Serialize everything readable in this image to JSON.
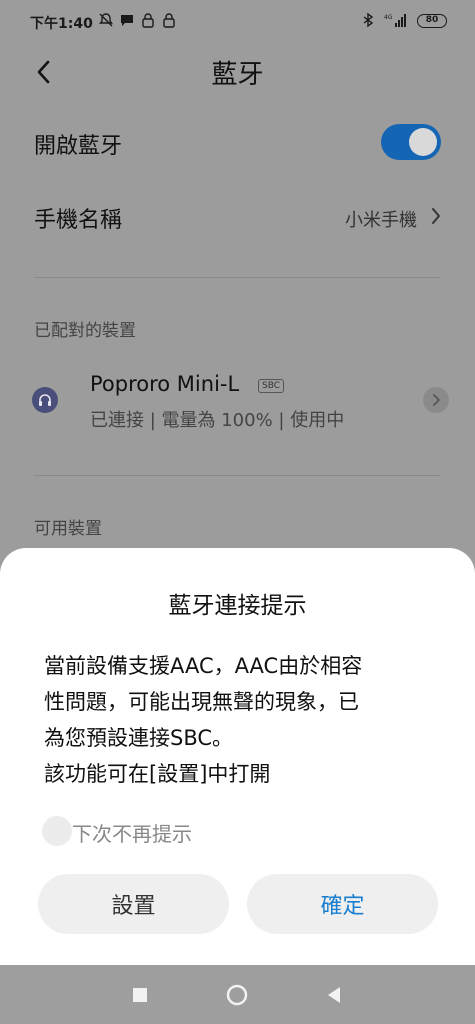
{
  "status_bar": {
    "time": "下午1:40",
    "battery": "80",
    "network": "4G"
  },
  "header": {
    "title": "藍牙",
    "back_icon": "chevron-left-icon"
  },
  "settings": {
    "bluetooth_toggle_label": "開啟藍牙",
    "bluetooth_enabled": true,
    "device_name_label": "手機名稱",
    "device_name_value": "小米手機"
  },
  "paired_section": {
    "header": "已配對的裝置",
    "devices": [
      {
        "name": "Poproro Mini-L",
        "codec": "SBC",
        "status": "已連接 | 電量為 100% | 使用中",
        "icon": "headphones-icon"
      }
    ]
  },
  "available_section": {
    "header": "可用裝置"
  },
  "dialog": {
    "title": "藍牙連接提示",
    "message_lines": [
      "當前設備支援AAC，AAC由於相容",
      "性問題，可能出現無聲的現象，已",
      "為您預設連接SBC。",
      "該功能可在[設置]中打開"
    ],
    "checkbox_label": "下次不再提示",
    "checkbox_checked": false,
    "settings_button": "設置",
    "confirm_button": "確定"
  },
  "colors": {
    "accent": "#1565b5",
    "confirm_text": "#1a7fd0",
    "dim_background": "#9c9c9c"
  }
}
